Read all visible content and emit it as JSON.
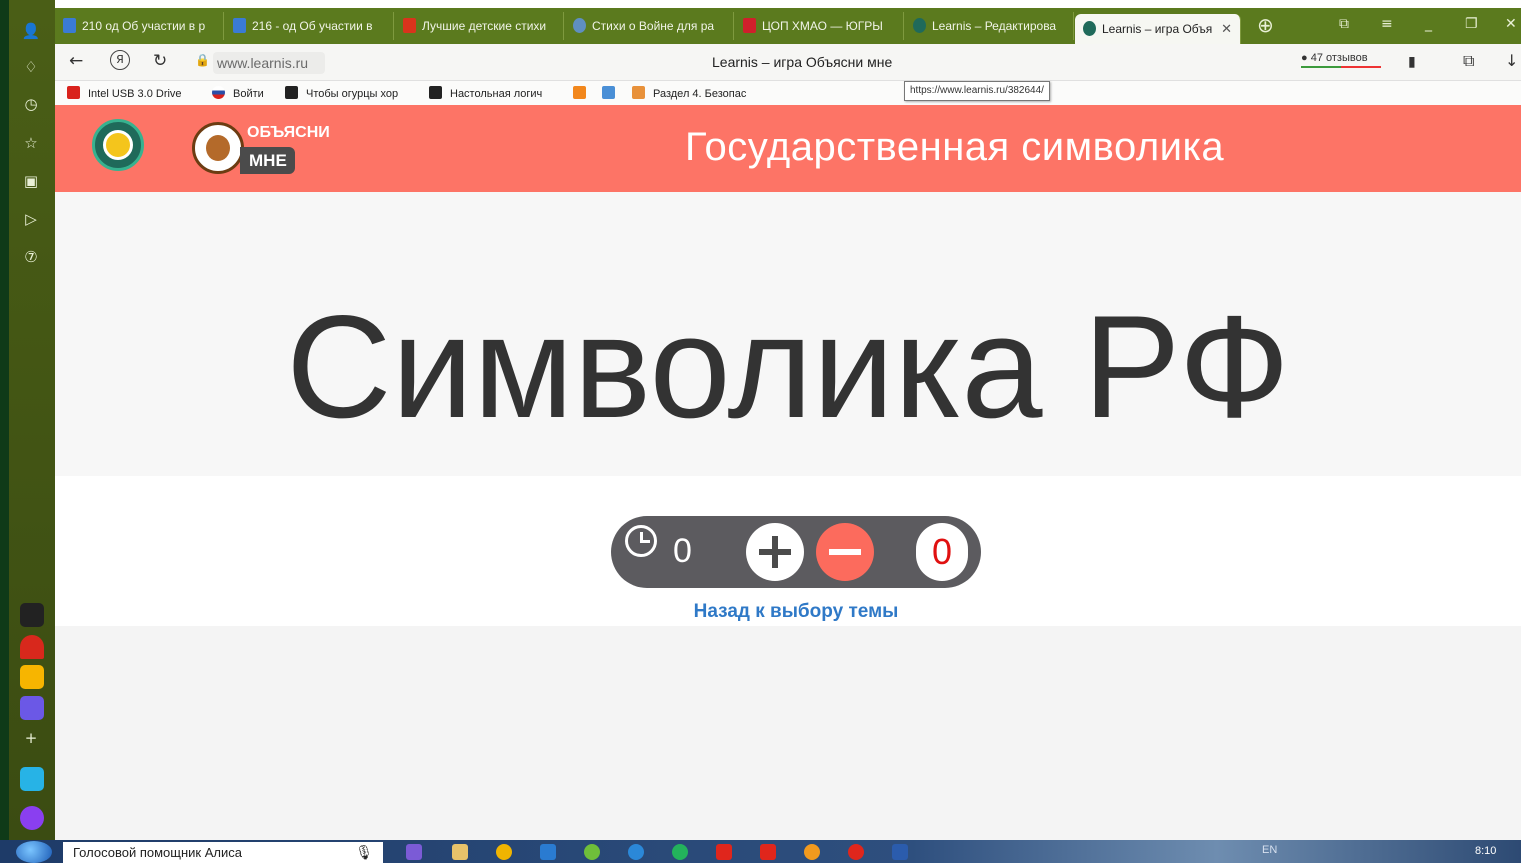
{
  "browser": {
    "tabs": [
      {
        "label": "210 од Об участии в р",
        "icon_color": "#3a7bd5"
      },
      {
        "label": "216 - од Об участии в",
        "icon_color": "#3a7bd5"
      },
      {
        "label": "Лучшие детские стихи",
        "icon_color": "#d9341c"
      },
      {
        "label": "Стихи о Войне для ра",
        "icon_color": "#5f8fc1"
      },
      {
        "label": "ЦОП ХМАО — ЮГРЫ",
        "icon_color": "#d01f2b"
      },
      {
        "label": "Learnis – Редактирова",
        "icon_color": "#1f6a5a"
      },
      {
        "label": "Learnis – игра Объя",
        "icon_color": "#1f6a5a",
        "active": true
      }
    ],
    "active_tab_close": "✕",
    "new_tab": "⊕",
    "url": "www.learnis.ru",
    "page_title": "Learnis – игра Объясни мне",
    "reviews": "47 отзывов",
    "tooltip": "https://www.learnis.ru/382644/",
    "bookmarks": [
      {
        "label": "Intel USB 3.0 Drive",
        "icon_color": "#d9221c"
      },
      {
        "label": "Войти",
        "icon_color": "#2b4fa8"
      },
      {
        "label": "Чтобы огурцы хор",
        "icon_color": "#222222"
      },
      {
        "label": "Настольная логич",
        "icon_color": "#222222"
      },
      {
        "label": "",
        "icon_color": "#f2871c"
      },
      {
        "label": "",
        "icon_color": "#4a8fd6"
      },
      {
        "label": "Раздел 4. Безопас",
        "icon_color": "#e8913a"
      }
    ],
    "window_controls": [
      "⧉",
      "≡",
      "_",
      "❐",
      "✕"
    ]
  },
  "site": {
    "logo_text_top": "ОБЪЯСНИ",
    "logo_text_bottom": "МНЕ",
    "header_title": "Государственная символика",
    "header_color": "#fd7466",
    "hero_title": "Символика РФ",
    "timer_value": "0",
    "score_value": "0",
    "back_link": "Назад к выбору темы",
    "accent_red": "#fc6b5d",
    "link_blue": "#2f79c7"
  },
  "taskbar": {
    "search_text": "Голосовой помощник Алиса",
    "tray_lang": "EN",
    "clock": "8:10"
  }
}
